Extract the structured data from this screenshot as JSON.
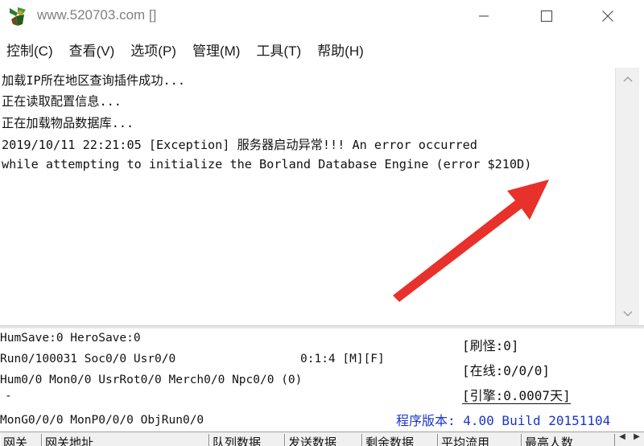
{
  "window": {
    "title": "www.520703.com []",
    "icon": "app-logo-icon",
    "controls": {
      "minimize": "minimize-icon",
      "maximize": "maximize-icon",
      "close": "close-icon"
    }
  },
  "menu": {
    "items": [
      "控制(C)",
      "查看(V)",
      "选项(P)",
      "管理(M)",
      "工具(T)",
      "帮助(H)"
    ]
  },
  "log": {
    "lines": [
      "加载IP所在地区查询插件成功...",
      "正在读取配置信息...",
      "正在加载物品数据库...",
      "2019/10/11 22:21:05 [Exception] 服务器启动异常!!! An error occurred",
      "while attempting to initialize the Borland Database Engine (error $210D)"
    ]
  },
  "status": {
    "line1": "HumSave:0 HeroSave:0",
    "line2": "Run0/100031 Soc0/0 Usr0/0",
    "time_flags": "0:1:4 [M][F]",
    "line3": "Hum0/0 Mon0/0 UsrRot0/0 Merch0/0 Npc0/0 (0)",
    "line4": "-",
    "line5": "MonG0/0/0 MonP0/0/0 ObjRun0/0",
    "right": {
      "refresh": "[刷怪:0]",
      "online": "[在线:0/0/0]",
      "engine": "[引擎:0.0007天]"
    },
    "version": "程序版本: 4.00 Build 20151104"
  },
  "tabs": {
    "columns": [
      "网关",
      "网关地址",
      "队列数据",
      "发送数据",
      "剩余数据",
      "平均流用",
      "最高人数"
    ]
  },
  "annotation": {
    "arrow_color": "#e8312a"
  }
}
